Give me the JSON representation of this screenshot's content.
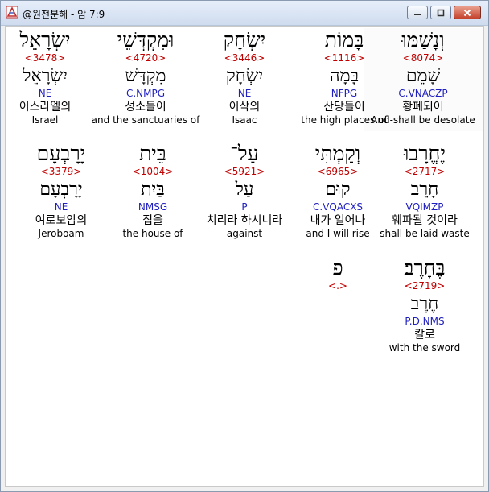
{
  "window": {
    "title": "@원전분해 - 암 7:9",
    "min_icon": "minimize-icon",
    "max_icon": "maximize-icon",
    "close_icon": "close-icon"
  },
  "rows": [
    [
      {
        "hebrew": "וְנָשַׁמּוּ",
        "strong": "<8074>",
        "lemma": "שָׁמֵם",
        "morph": "C.VNACZP",
        "korean": "황폐되어",
        "english": "And-shall be desolate",
        "highlight": true
      },
      {
        "hebrew": "בָּמוֹת",
        "strong": "<1116>",
        "lemma": "בָּמָה",
        "morph": "NFPG",
        "korean": "산당들이",
        "english": "the high places of"
      },
      {
        "hebrew": "יִשְׂחָק",
        "strong": "<3446>",
        "lemma": "יִשְׂחָק",
        "morph": "NE",
        "korean": "이삭의",
        "english": "Isaac"
      },
      {
        "hebrew": "וּמִקְדְּשֵׁי",
        "strong": "<4720>",
        "lemma": "מִקְדָּשׁ",
        "morph": "C.NMPG",
        "korean": "성소들이",
        "english": "and the sanctuaries of"
      },
      {
        "hebrew": "יִשְׂרָאֵל",
        "strong": "<3478>",
        "lemma": "יִשְׂרָאֵל",
        "morph": "NE",
        "korean": "이스라엘의",
        "english": "Israel"
      }
    ],
    [
      {
        "hebrew": "יֶחֱרָבוּ",
        "strong": "<2717>",
        "lemma": "חָרֵב",
        "morph": "VQIMZP",
        "korean": "훼파될 것이라",
        "english": "shall be laid waste"
      },
      {
        "hebrew": "וְקַמְתִּי",
        "strong": "<6965>",
        "lemma": "קוּם",
        "morph": "C.VQACXS",
        "korean": "내가 일어나",
        "english": "and I will rise"
      },
      {
        "hebrew": "עַל־",
        "strong": "<5921>",
        "lemma": "עַל",
        "morph": "P",
        "korean": "치리라 하시니라",
        "english": "against"
      },
      {
        "hebrew": "בֵּית",
        "strong": "<1004>",
        "lemma": "בַּיִת",
        "morph": "NMSG",
        "korean": "집을",
        "english": "the house of"
      },
      {
        "hebrew": "יָרָבְעָם",
        "strong": "<3379>",
        "lemma": "יָרָבְעָם",
        "morph": "NE",
        "korean": "여로보암의",
        "english": "Jeroboam"
      }
    ],
    [
      {
        "hebrew": "בֶּחָרֶב׃",
        "strong": "<2719>",
        "lemma": "חֶרֶב",
        "morph": "P.D.NMS",
        "korean": "칼로",
        "english": "with the sword"
      },
      {
        "hebrew": "פ",
        "strong": "<.>",
        "lemma": "",
        "morph": "",
        "korean": "",
        "english": ""
      }
    ]
  ]
}
